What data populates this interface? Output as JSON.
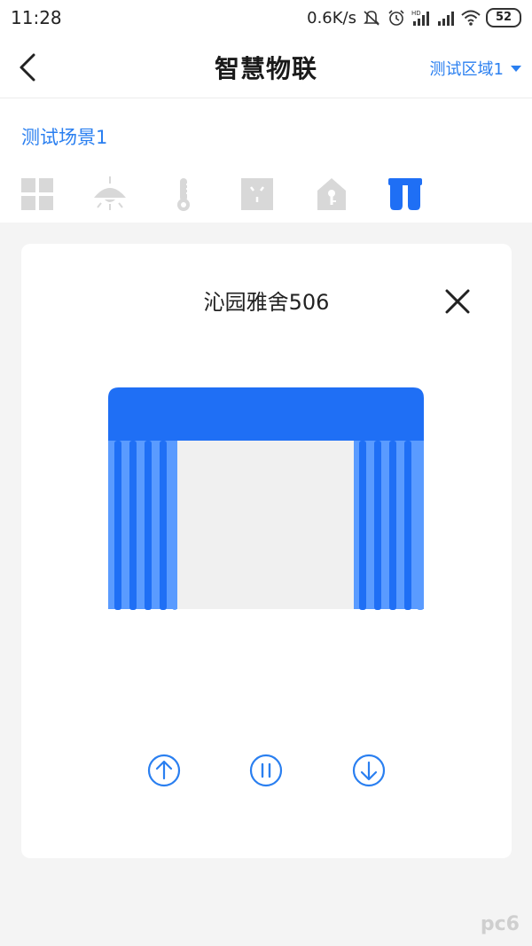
{
  "status_bar": {
    "time": "11:28",
    "network_speed": "0.6K/s",
    "battery": "52",
    "icons": [
      "mute-icon",
      "alarm-icon",
      "hd-signal-icon",
      "signal-icon",
      "wifi-icon",
      "battery-icon"
    ]
  },
  "header": {
    "back_icon": "back-arrow-icon",
    "title": "智慧物联",
    "area_label": "测试区域1",
    "area_caret_icon": "caret-down-icon"
  },
  "scene": {
    "name": "测试场景1"
  },
  "category_tabs": [
    {
      "icon": "grid-icon",
      "active": false
    },
    {
      "icon": "ceiling-lamp-icon",
      "active": false
    },
    {
      "icon": "thermometer-icon",
      "active": false
    },
    {
      "icon": "socket-icon",
      "active": false
    },
    {
      "icon": "door-lock-icon",
      "active": false
    },
    {
      "icon": "curtain-icon",
      "active": true
    }
  ],
  "device": {
    "name": "沁园雅舍506",
    "close_icon": "close-icon",
    "illustration": "curtain-open-illustration",
    "controls": [
      {
        "name": "open-button",
        "icon": "arrow-up-circle-icon"
      },
      {
        "name": "pause-button",
        "icon": "pause-circle-icon"
      },
      {
        "name": "close-curtain-button",
        "icon": "arrow-down-circle-icon"
      }
    ]
  },
  "colors": {
    "accent": "#2a7ff0",
    "curtain_primary": "#1f6ff5",
    "curtain_light": "#5a9bff",
    "inactive_icon": "#d8d8d8",
    "background": "#f4f4f4",
    "card": "#ffffff"
  },
  "watermark": "pc6"
}
